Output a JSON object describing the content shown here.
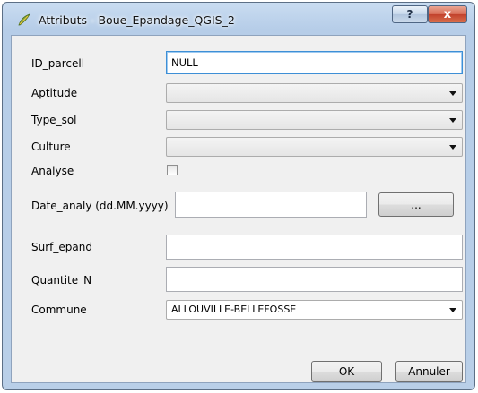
{
  "window": {
    "title": "Attributs - Boue_Epandage_QGIS_2",
    "help_label": "?",
    "close_label": "x"
  },
  "form": {
    "id_parcell": {
      "label": "ID_parcell",
      "value": "NULL"
    },
    "aptitude": {
      "label": "Aptitude",
      "value": ""
    },
    "type_sol": {
      "label": "Type_sol",
      "value": ""
    },
    "culture": {
      "label": "Culture",
      "value": ""
    },
    "analyse": {
      "label": "Analyse",
      "checked": false
    },
    "date_analy": {
      "label": "Date_analy (dd.MM.yyyy)",
      "value": "",
      "picker_label": "..."
    },
    "surf_epand": {
      "label": "Surf_epand",
      "value": ""
    },
    "quantite_n": {
      "label": "Quantite_N",
      "value": ""
    },
    "commune": {
      "label": "Commune",
      "value": "ALLOUVILLE-BELLEFOSSE"
    }
  },
  "buttons": {
    "ok": "OK",
    "cancel": "Annuler"
  },
  "icons": {
    "app": "qgis-logo-icon",
    "dropdown": "chevron-down-icon"
  }
}
